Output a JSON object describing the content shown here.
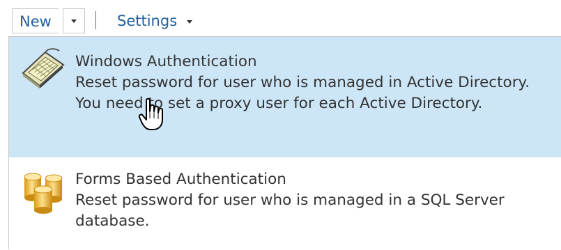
{
  "toolbar": {
    "new_label": "New",
    "settings_label": "Settings"
  },
  "menu": {
    "items": [
      {
        "title": "Windows Authentication",
        "description": "Reset password for user who is managed in Active Directory. You need to set a proxy user for each Active Directory.",
        "icon": "keyboard-icon",
        "highlighted": true
      },
      {
        "title": "Forms Based Authentication",
        "description": "Reset password for user who is managed in a SQL Server database.",
        "icon": "database-icon",
        "highlighted": false
      }
    ]
  },
  "colors": {
    "link": "#1f5f9e",
    "highlight": "#cde6f7",
    "text": "#333333"
  }
}
